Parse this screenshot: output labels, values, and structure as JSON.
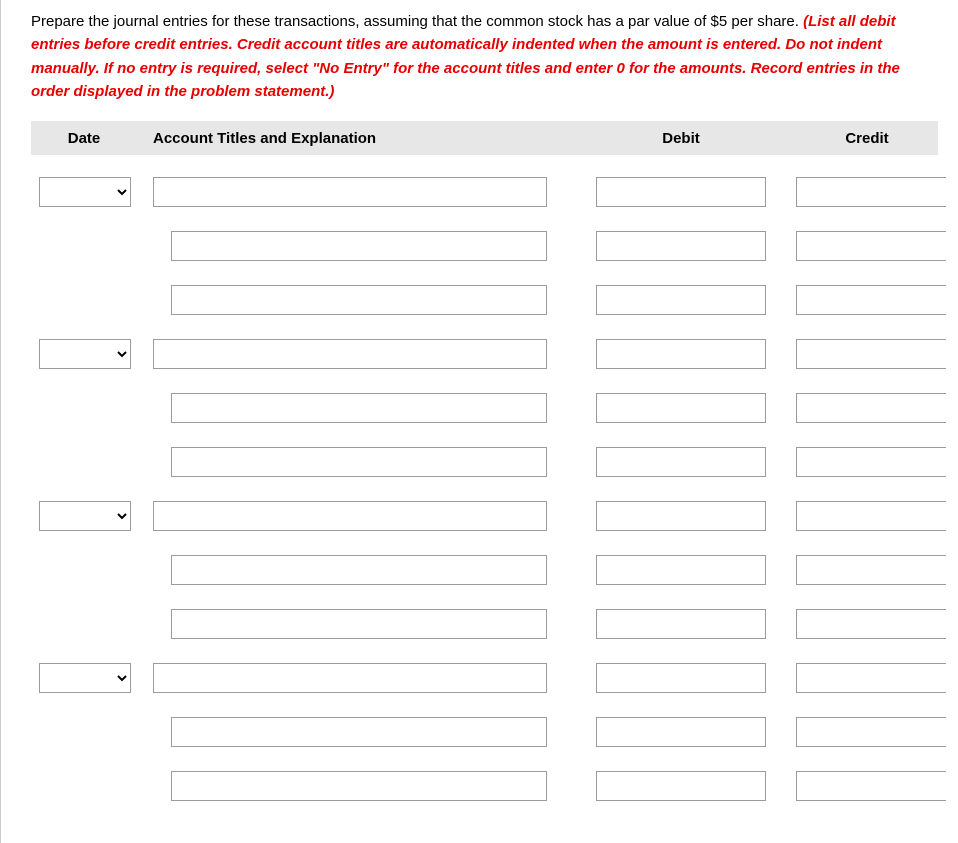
{
  "instructions": {
    "normal": "Prepare the journal entries for these transactions, assuming that the common stock has a par value of $5 per share. ",
    "highlight": "(List all debit entries before credit entries. Credit account titles are automatically indented when the amount is entered. Do not indent manually. If no entry is required, select \"No Entry\" for the account titles and enter 0 for the amounts. Record entries in the order displayed in the problem statement.)"
  },
  "headers": {
    "date": "Date",
    "account": "Account Titles and Explanation",
    "debit": "Debit",
    "credit": "Credit"
  },
  "entries": [
    {
      "date": "",
      "rows": [
        {
          "indent": false,
          "account": "",
          "debit": "",
          "credit": ""
        },
        {
          "indent": true,
          "account": "",
          "debit": "",
          "credit": ""
        },
        {
          "indent": true,
          "account": "",
          "debit": "",
          "credit": ""
        }
      ]
    },
    {
      "date": "",
      "rows": [
        {
          "indent": false,
          "account": "",
          "debit": "",
          "credit": ""
        },
        {
          "indent": true,
          "account": "",
          "debit": "",
          "credit": ""
        },
        {
          "indent": true,
          "account": "",
          "debit": "",
          "credit": ""
        }
      ]
    },
    {
      "date": "",
      "rows": [
        {
          "indent": false,
          "account": "",
          "debit": "",
          "credit": ""
        },
        {
          "indent": true,
          "account": "",
          "debit": "",
          "credit": ""
        },
        {
          "indent": true,
          "account": "",
          "debit": "",
          "credit": ""
        }
      ]
    },
    {
      "date": "",
      "rows": [
        {
          "indent": false,
          "account": "",
          "debit": "",
          "credit": ""
        },
        {
          "indent": true,
          "account": "",
          "debit": "",
          "credit": ""
        },
        {
          "indent": true,
          "account": "",
          "debit": "",
          "credit": ""
        }
      ]
    }
  ]
}
